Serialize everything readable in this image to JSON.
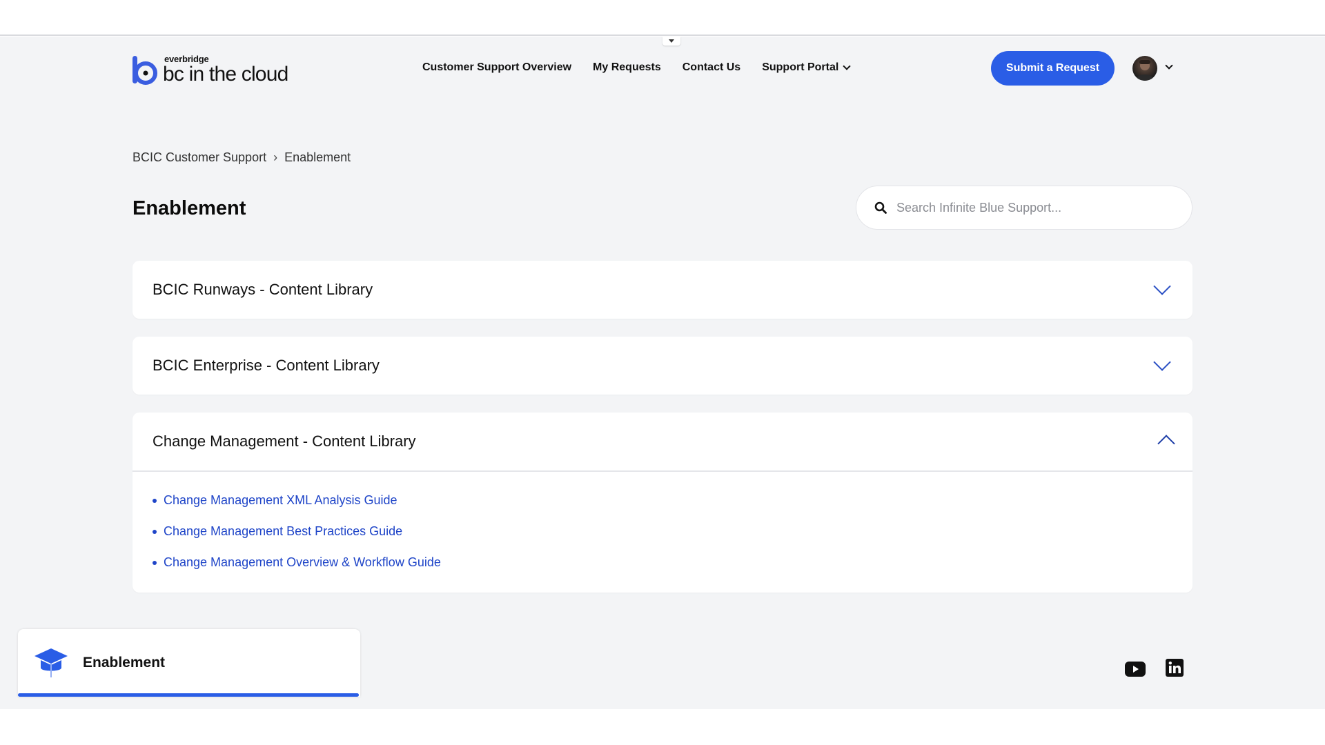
{
  "header": {
    "logo_small": "everbridge",
    "logo_big": "bc in the cloud",
    "nav": [
      {
        "label": "Customer Support Overview"
      },
      {
        "label": "My Requests"
      },
      {
        "label": "Contact Us"
      },
      {
        "label": "Support Portal"
      }
    ],
    "submit_label": "Submit a Request"
  },
  "breadcrumb": [
    "BCIC Customer Support",
    "Enablement"
  ],
  "breadcrumb_separator": "›",
  "page_title": "Enablement",
  "search": {
    "placeholder": "Search Infinite Blue Support..."
  },
  "accordions": [
    {
      "title": "BCIC Runways - Content Library",
      "expanded": false
    },
    {
      "title": "BCIC Enterprise - Content Library",
      "expanded": false
    },
    {
      "title": "Change Management - Content Library",
      "expanded": true,
      "links": [
        "Change Management XML Analysis Guide",
        "Change Management Best Practices Guide",
        "Change Management Overview & Workflow Guide"
      ]
    }
  ],
  "bottom_tab": {
    "label": "Enablement",
    "icon": "graduation-cap-icon"
  },
  "social": [
    "youtube-icon",
    "linkedin-icon"
  ],
  "colors": {
    "accent": "#2a5de6",
    "link": "#1f45c8",
    "background": "#f3f4f6"
  }
}
